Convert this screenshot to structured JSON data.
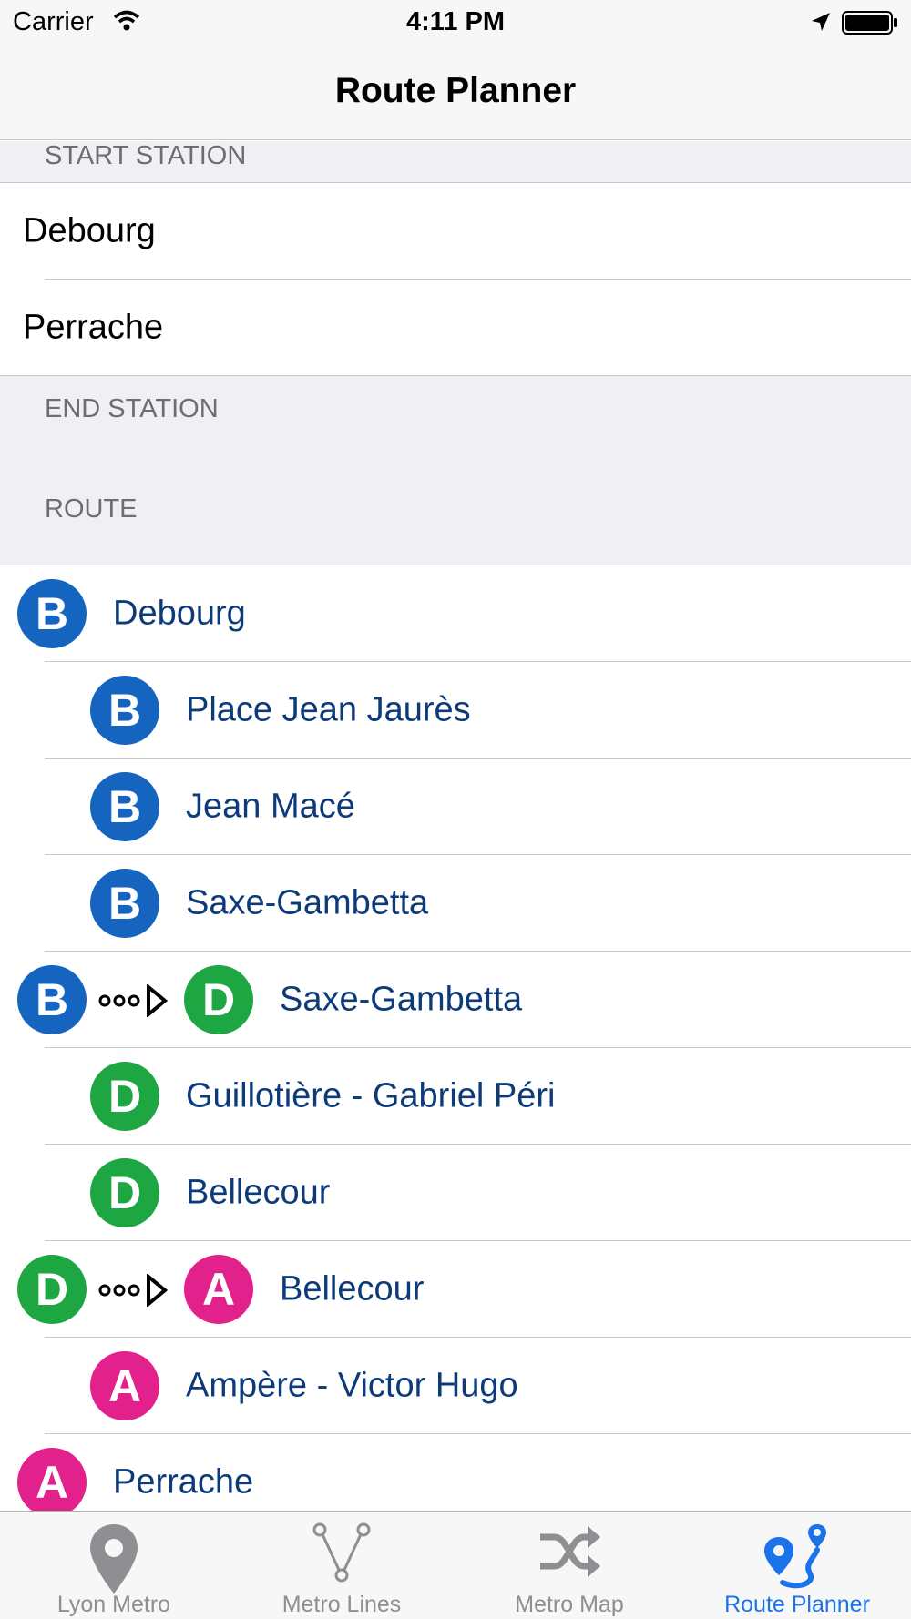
{
  "status": {
    "carrier": "Carrier",
    "time": "4:11 PM"
  },
  "nav": {
    "title": "Route Planner"
  },
  "sections": {
    "start": "START STATION",
    "end": "END STATION",
    "route": "ROUTE"
  },
  "stations": [
    {
      "name": "Debourg"
    },
    {
      "name": "Perrache"
    }
  ],
  "route": [
    {
      "name": "Debourg",
      "line": "B",
      "type": "start"
    },
    {
      "name": "Place Jean Jaurès",
      "line": "B",
      "type": "stop"
    },
    {
      "name": "Jean Macé",
      "line": "B",
      "type": "stop"
    },
    {
      "name": "Saxe-Gambetta",
      "line": "B",
      "type": "stop"
    },
    {
      "name": "Saxe-Gambetta",
      "from": "B",
      "line": "D",
      "type": "transfer"
    },
    {
      "name": "Guillotière - Gabriel Péri",
      "line": "D",
      "type": "stop"
    },
    {
      "name": "Bellecour",
      "line": "D",
      "type": "stop"
    },
    {
      "name": "Bellecour",
      "from": "D",
      "line": "A",
      "type": "transfer"
    },
    {
      "name": "Ampère - Victor Hugo",
      "line": "A",
      "type": "stop"
    },
    {
      "name": "Perrache",
      "line": "A",
      "type": "end"
    }
  ],
  "line_colors": {
    "A": "#e3218c",
    "B": "#1565c0",
    "D": "#1ea643"
  },
  "tabs": [
    {
      "label": "Lyon Metro",
      "icon": "map-pin-icon",
      "active": false
    },
    {
      "label": "Metro Lines",
      "icon": "metro-lines-icon",
      "active": false
    },
    {
      "label": "Metro Map",
      "icon": "shuffle-icon",
      "active": false
    },
    {
      "label": "Route Planner",
      "icon": "route-planner-icon",
      "active": true
    }
  ],
  "colors": {
    "accent": "#1a73e8",
    "route_text": "#0d3b7a"
  }
}
